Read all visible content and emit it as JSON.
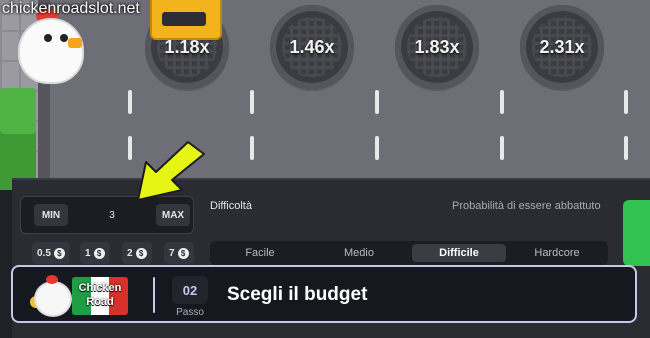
{
  "watermark": "chickenroadslot.net",
  "game": {
    "multipliers": [
      "1.18x",
      "1.46x",
      "1.83x",
      "2.31x"
    ]
  },
  "bet": {
    "min_label": "MIN",
    "max_label": "MAX",
    "value": "3",
    "quick_bets": [
      {
        "amount": "0.5",
        "currency": "$"
      },
      {
        "amount": "1",
        "currency": "$"
      },
      {
        "amount": "2",
        "currency": "$"
      },
      {
        "amount": "7",
        "currency": "$"
      }
    ]
  },
  "difficulty": {
    "label": "Difficoltà",
    "probability_label": "Probabilità di essere abbattuto",
    "tabs": [
      "Facile",
      "Medio",
      "Difficile",
      "Hardcore"
    ],
    "active": "Difficile"
  },
  "banner": {
    "logo_line1": "Chicken",
    "logo_line2": "Road",
    "step_number": "02",
    "step_label": "Passo",
    "title": "Scegli il budget"
  },
  "colors": {
    "arrow": "#e6f514",
    "play_button": "#31c24f",
    "banner_border": "#c9c6ee",
    "flag_green": "#1f9e45",
    "flag_white": "#ffffff",
    "flag_red": "#d6312a"
  }
}
